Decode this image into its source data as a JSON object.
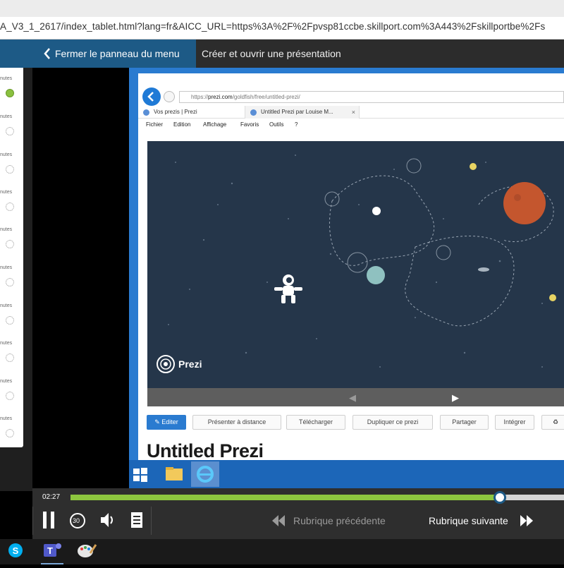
{
  "browser": {
    "url": "A_V3_1_2617/index_tablet.html?lang=fr&AICC_URL=https%3A%2F%2Fpvsp81ccbe.skillport.com%3A443%2Fskillportbe%2Fs"
  },
  "header": {
    "menu_toggle_label": "Fermer le panneau du menu",
    "topic_title": "Créer et ouvrir une présentation"
  },
  "sidebar": {
    "item_label": "nutes",
    "items": [
      {
        "label": "nutes",
        "done": true
      },
      {
        "label": "nutes",
        "done": false
      },
      {
        "label": "nutes",
        "done": false
      },
      {
        "label": "nutes",
        "done": false
      },
      {
        "label": "nutes",
        "done": false
      },
      {
        "label": "nutes",
        "done": false
      },
      {
        "label": "nutes",
        "done": false
      },
      {
        "label": "nutes",
        "done": false
      },
      {
        "label": "nutes",
        "done": false
      },
      {
        "label": "nutes",
        "done": false
      }
    ]
  },
  "video": {
    "address_prefix": "https://",
    "address_host": "prezi.com",
    "address_path": "/goldfish/free/untitled-prezi/",
    "tabs": [
      {
        "label": "Vos prezis | Prezi"
      },
      {
        "label": "Untitled Prezi par Louise M..."
      }
    ],
    "tab_close": "×",
    "menu": [
      "Fichier",
      "Edition",
      "Affichage",
      "Favoris",
      "Outils",
      "?"
    ],
    "logo_text": "Prezi",
    "actions": {
      "edit": "✎ Editer",
      "present_remote": "Présenter à distance",
      "download": "Télécharger",
      "duplicate": "Dupliquer ce prezi",
      "share": "Partager",
      "embed": "Intégrer"
    },
    "prezi_title": "Untitled Prezi"
  },
  "player": {
    "elapsed": "02:27",
    "progress_fraction": 0.87,
    "prev_topic": "Rubrique précédente",
    "next_topic": "Rubrique suivante",
    "replay_seconds": "30"
  },
  "colors": {
    "accent": "#1d5a86",
    "progress": "#8dc63f",
    "done": "#8ac03f",
    "screen_blue": "#2a7bd0"
  }
}
